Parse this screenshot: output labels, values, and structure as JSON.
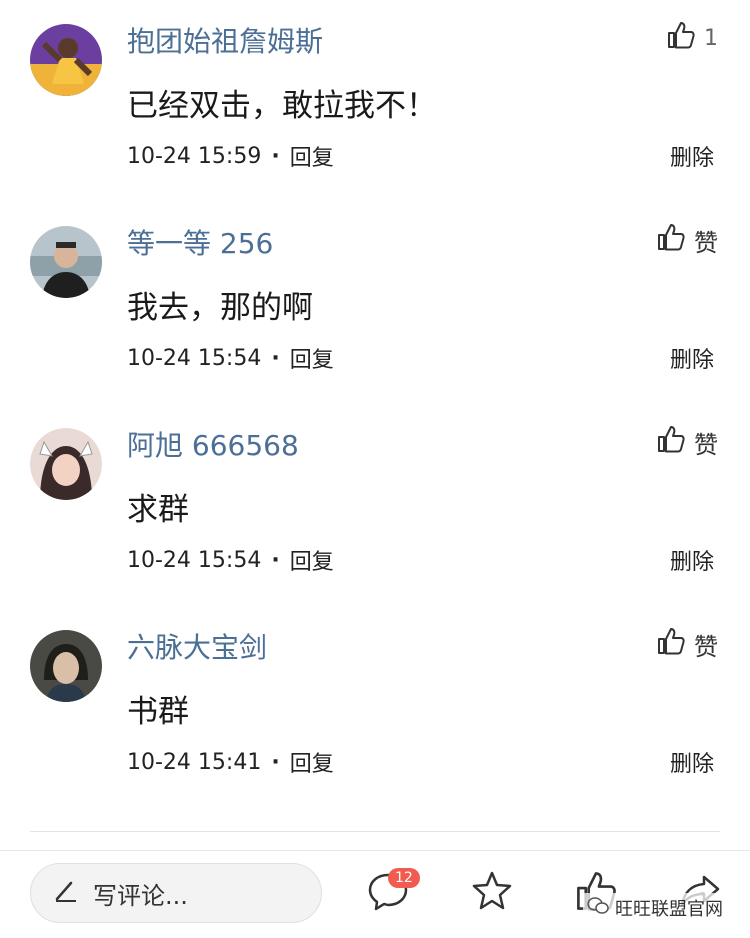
{
  "comments": [
    {
      "username": "抱团始祖詹姆斯",
      "text": "已经双击，敢拉我不！",
      "time": "10-24 15:59",
      "reply": "回复",
      "delete": "删除",
      "like_count": "1",
      "like_label": ""
    },
    {
      "username": "等一等 256",
      "text": "我去，那的啊",
      "time": "10-24 15:54",
      "reply": "回复",
      "delete": "删除",
      "like_count": "",
      "like_label": "赞"
    },
    {
      "username": "阿旭 666568",
      "text": "求群",
      "time": "10-24 15:54",
      "reply": "回复",
      "delete": "删除",
      "like_count": "",
      "like_label": "赞"
    },
    {
      "username": "六脉大宝剑",
      "text": "书群",
      "time": "10-24 15:41",
      "reply": "回复",
      "delete": "删除",
      "like_count": "",
      "like_label": "赞"
    }
  ],
  "bottom_bar": {
    "compose_placeholder": "写评论...",
    "comment_badge": "12",
    "icons": [
      "comment-icon",
      "star-icon",
      "thumb-up-icon",
      "share-icon"
    ]
  },
  "watermark": "旺旺联盟官网",
  "colors": {
    "username": "#4c6f95",
    "badge": "#f15b50",
    "text": "#1a1a1a"
  }
}
